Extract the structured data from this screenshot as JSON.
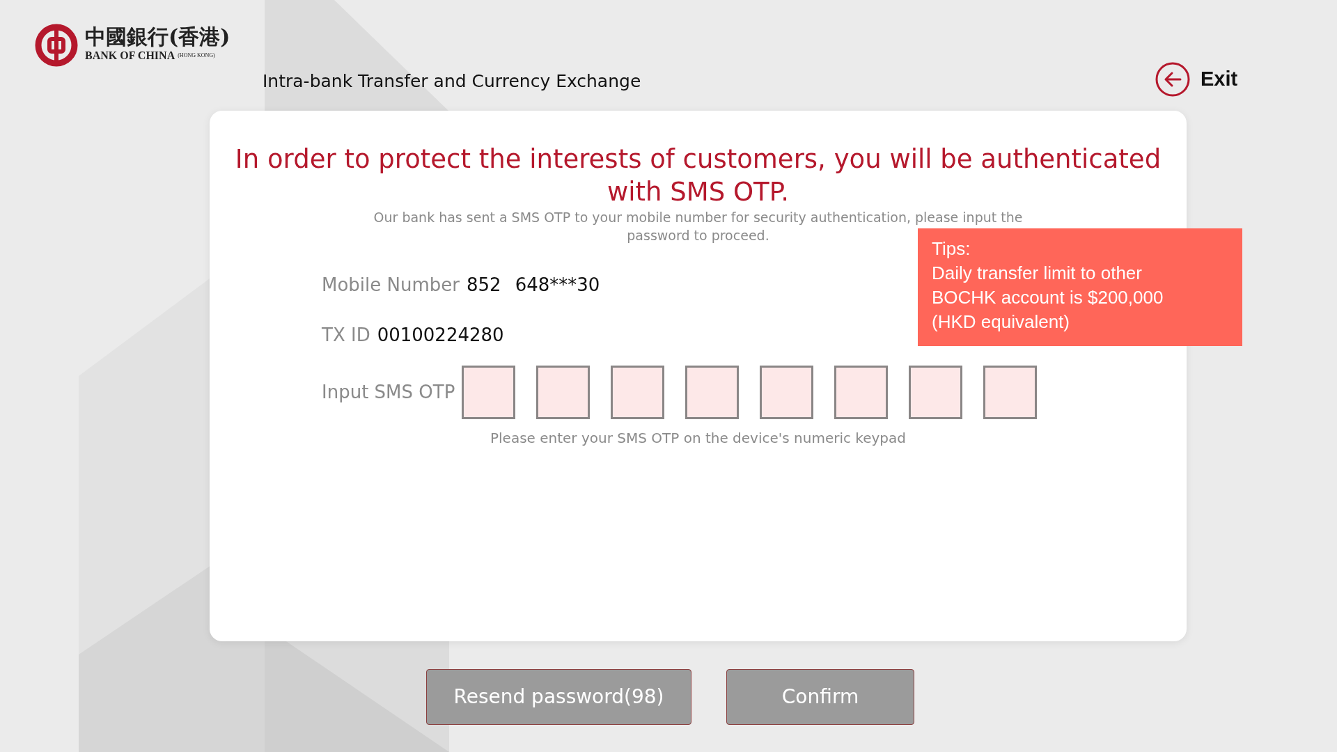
{
  "logo": {
    "chinese": "中國銀行(香港)",
    "english": "BANK OF CHINA",
    "region": "(HONG KONG)"
  },
  "page_title": "Intra-bank Transfer and Currency Exchange",
  "exit": {
    "label": "Exit"
  },
  "heading": "In order to protect the interests of customers, you will be authenticated with SMS OTP.",
  "subheading": "Our bank has sent a SMS OTP to your mobile number for security authentication, please input the password to proceed.",
  "fields": [
    {
      "label": "Mobile Number",
      "values": [
        "852",
        "648***30"
      ]
    },
    {
      "label": "TX ID",
      "values": [
        "00100224280"
      ]
    }
  ],
  "otp": {
    "label": "Input SMS OTP",
    "boxes": [
      {
        "filled": false
      },
      {
        "filled": false
      },
      {
        "filled": false
      },
      {
        "filled": false
      },
      {
        "filled": false
      },
      {
        "filled": false
      },
      {
        "filled": false
      },
      {
        "filled": false
      }
    ],
    "hint": "Please enter your SMS OTP on the device's numeric keypad"
  },
  "tips": {
    "title": "Tips:",
    "lines": [
      "Daily transfer limit to other",
      "BOCHK account is $200,000",
      "(HKD equivalent)"
    ]
  },
  "buttons": [
    "Resend password(98)",
    "Confirm"
  ]
}
